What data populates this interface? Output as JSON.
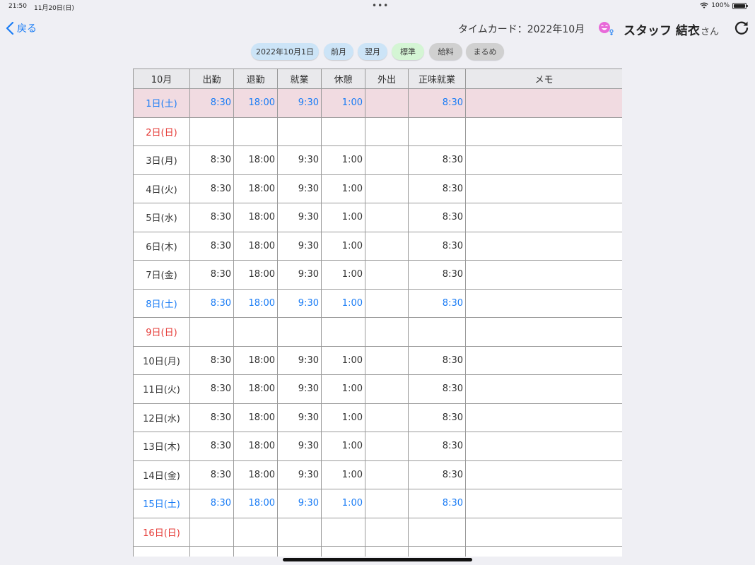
{
  "status": {
    "time": "21:50",
    "date": "11月20日(日)",
    "battery": "100%"
  },
  "nav": {
    "back_label": "戻る"
  },
  "header": {
    "title": "タイムカード：2022年10月",
    "staff_name": "スタッフ 結衣",
    "honorific": "さん"
  },
  "buttons": [
    {
      "label": "2022年10月1日",
      "style": "blue"
    },
    {
      "label": "前月",
      "style": "blue"
    },
    {
      "label": "翌月",
      "style": "blue"
    },
    {
      "label": "標準",
      "style": "green"
    },
    {
      "label": "給料",
      "style": "gray"
    },
    {
      "label": "まるめ",
      "style": "gray"
    }
  ],
  "table": {
    "headers": [
      "10月",
      "出勤",
      "退勤",
      "就業",
      "休憩",
      "外出",
      "正味就業",
      "メモ"
    ],
    "rows": [
      {
        "day": "1日(土)",
        "type": "sat",
        "highlight": true,
        "cells": [
          "8:30",
          "18:00",
          "9:30",
          "1:00",
          "",
          "8:30",
          ""
        ]
      },
      {
        "day": "2日(日)",
        "type": "sun",
        "cells": [
          "",
          "",
          "",
          "",
          "",
          "",
          ""
        ]
      },
      {
        "day": "3日(月)",
        "type": "weekday",
        "cells": [
          "8:30",
          "18:00",
          "9:30",
          "1:00",
          "",
          "8:30",
          ""
        ]
      },
      {
        "day": "4日(火)",
        "type": "weekday",
        "cells": [
          "8:30",
          "18:00",
          "9:30",
          "1:00",
          "",
          "8:30",
          ""
        ]
      },
      {
        "day": "5日(水)",
        "type": "weekday",
        "cells": [
          "8:30",
          "18:00",
          "9:30",
          "1:00",
          "",
          "8:30",
          ""
        ]
      },
      {
        "day": "6日(木)",
        "type": "weekday",
        "cells": [
          "8:30",
          "18:00",
          "9:30",
          "1:00",
          "",
          "8:30",
          ""
        ]
      },
      {
        "day": "7日(金)",
        "type": "weekday",
        "cells": [
          "8:30",
          "18:00",
          "9:30",
          "1:00",
          "",
          "8:30",
          ""
        ]
      },
      {
        "day": "8日(土)",
        "type": "sat",
        "cells": [
          "8:30",
          "18:00",
          "9:30",
          "1:00",
          "",
          "8:30",
          ""
        ]
      },
      {
        "day": "9日(日)",
        "type": "sun",
        "cells": [
          "",
          "",
          "",
          "",
          "",
          "",
          ""
        ]
      },
      {
        "day": "10日(月)",
        "type": "weekday",
        "cells": [
          "8:30",
          "18:00",
          "9:30",
          "1:00",
          "",
          "8:30",
          ""
        ]
      },
      {
        "day": "11日(火)",
        "type": "weekday",
        "cells": [
          "8:30",
          "18:00",
          "9:30",
          "1:00",
          "",
          "8:30",
          ""
        ]
      },
      {
        "day": "12日(水)",
        "type": "weekday",
        "cells": [
          "8:30",
          "18:00",
          "9:30",
          "1:00",
          "",
          "8:30",
          ""
        ]
      },
      {
        "day": "13日(木)",
        "type": "weekday",
        "cells": [
          "8:30",
          "18:00",
          "9:30",
          "1:00",
          "",
          "8:30",
          ""
        ]
      },
      {
        "day": "14日(金)",
        "type": "weekday",
        "cells": [
          "8:30",
          "18:00",
          "9:30",
          "1:00",
          "",
          "8:30",
          ""
        ]
      },
      {
        "day": "15日(土)",
        "type": "sat",
        "cells": [
          "8:30",
          "18:00",
          "9:30",
          "1:00",
          "",
          "8:30",
          ""
        ]
      },
      {
        "day": "16日(日)",
        "type": "sun",
        "cells": [
          "",
          "",
          "",
          "",
          "",
          "",
          ""
        ]
      },
      {
        "day": "",
        "type": "weekday",
        "cells": [
          "",
          "",
          "",
          "",
          "",
          "",
          ""
        ]
      }
    ]
  },
  "colors": {
    "accent": "#1a7cf5",
    "saturday": "#1a7cf5",
    "sunday": "#e53935",
    "highlight_row": "#f1dbe1",
    "avatar": "#e86ad9"
  },
  "icons": {
    "back": "chevron-left-icon",
    "avatar": "smiley-face-icon",
    "gender": "female-symbol-icon",
    "refresh": "refresh-icon",
    "wifi": "wifi-icon",
    "battery": "battery-icon"
  }
}
